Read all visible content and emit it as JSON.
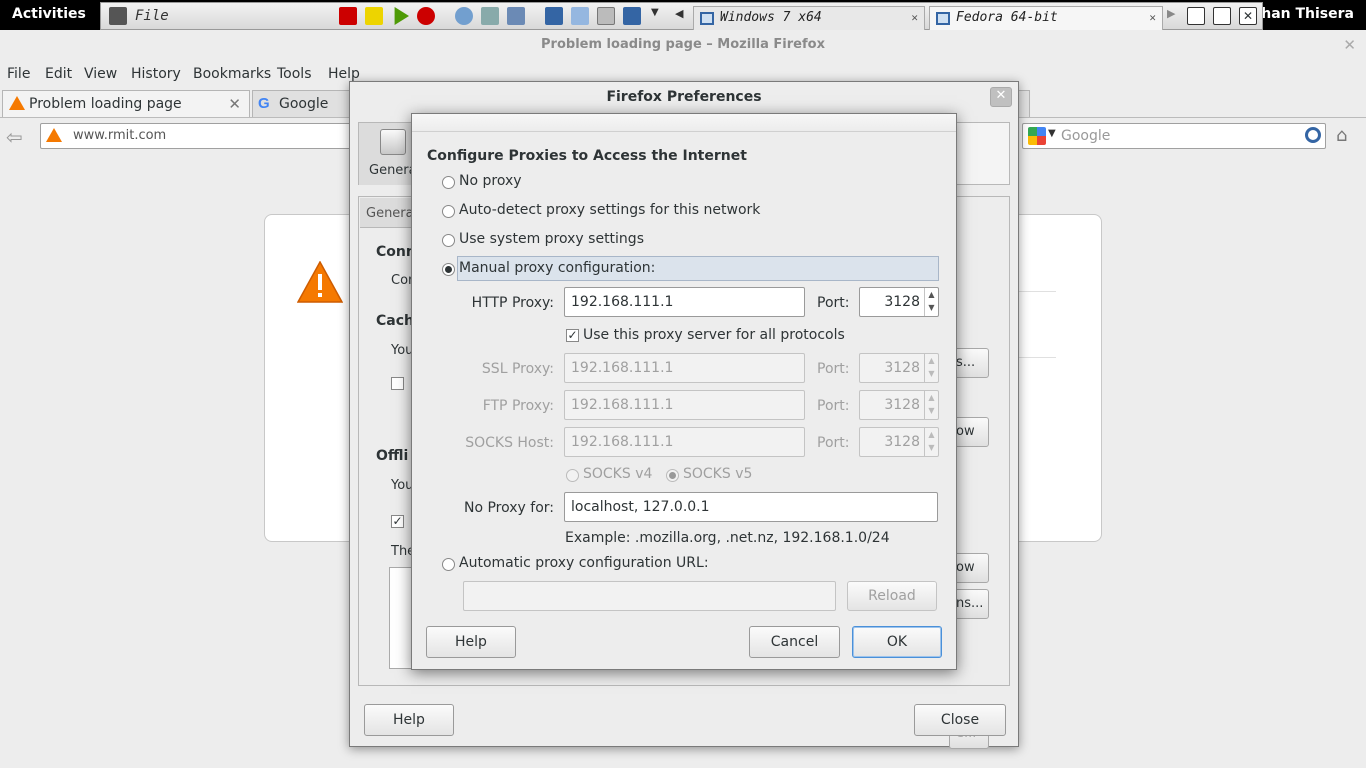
{
  "topbar": {
    "activities": "Activities",
    "user": "shan Thisera"
  },
  "vm": {
    "file_label": "File",
    "tabs": [
      {
        "label": "Windows 7 x64"
      },
      {
        "label": "Fedora 64-bit"
      }
    ]
  },
  "firefox": {
    "window_title": "Problem loading page – Mozilla Firefox",
    "menu": [
      "File",
      "Edit",
      "View",
      "History",
      "Bookmarks",
      "Tools",
      "Help"
    ],
    "tabs": [
      {
        "label": "Problem loading page"
      },
      {
        "label": "Google"
      }
    ],
    "url": "www.rmit.com",
    "search_placeholder": "Google"
  },
  "prefs": {
    "title": "Firefox Preferences",
    "pane_label": "Genera",
    "subtab": "Genera",
    "fragments": {
      "conn": "Conn",
      "con": "Con",
      "cach": "Cach",
      "you1": "You",
      "offli": "Offli",
      "you2": "You",
      "the": "The",
      "btn_settings": "s...",
      "btn_now1": "ow",
      "btn_now2": "ow",
      "btn_exceptions": "ns...",
      "btn_remove": "e..."
    },
    "help": "Help",
    "close": "Close"
  },
  "conn": {
    "heading": "Configure Proxies to Access the Internet",
    "options": {
      "no_proxy": "No proxy",
      "auto_detect": "Auto-detect proxy settings for this network",
      "system": "Use system proxy settings",
      "manual": "Manual proxy configuration:",
      "auto_url": "Automatic proxy configuration URL:"
    },
    "selected": "manual",
    "http": {
      "label": "HTTP Proxy:",
      "value": "192.168.111.1",
      "port_label": "Port:",
      "port": "3128"
    },
    "use_all": {
      "label": "Use this proxy server for all protocols",
      "checked": true
    },
    "ssl": {
      "label": "SSL Proxy:",
      "value": "192.168.111.1",
      "port_label": "Port:",
      "port": "3128"
    },
    "ftp": {
      "label": "FTP Proxy:",
      "value": "192.168.111.1",
      "port_label": "Port:",
      "port": "3128"
    },
    "socks": {
      "label": "SOCKS Host:",
      "value": "192.168.111.1",
      "port_label": "Port:",
      "port": "3128"
    },
    "socks_v4": "SOCKS v4",
    "socks_v5": "SOCKS v5",
    "no_proxy_for": {
      "label": "No Proxy for:",
      "value": "localhost, 127.0.0.1"
    },
    "example": "Example: .mozilla.org, .net.nz, 192.168.1.0/24",
    "auto_url_value": "",
    "reload": "Reload",
    "help": "Help",
    "cancel": "Cancel",
    "ok": "OK"
  },
  "colors": {
    "accent": "#4a90d9",
    "warning": "#f57900",
    "highlight": "#dbe3ec"
  }
}
